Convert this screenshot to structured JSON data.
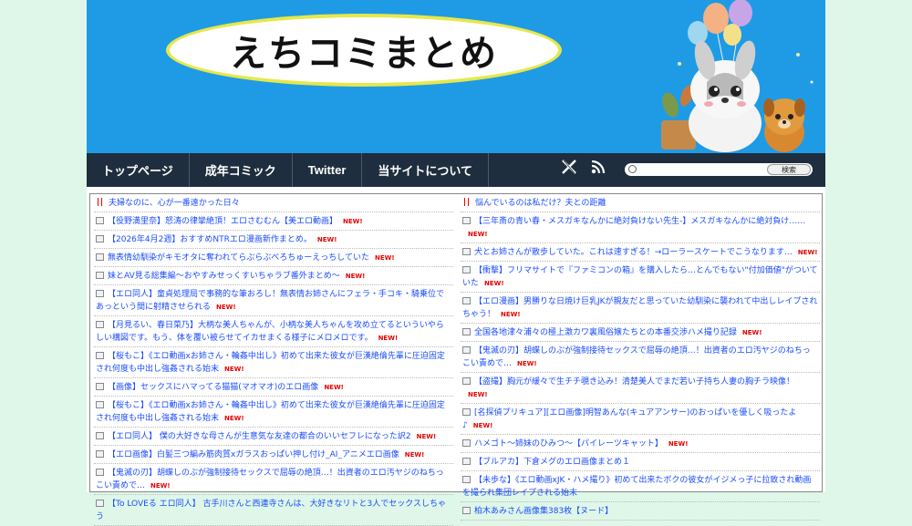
{
  "site": {
    "title": "えちコミまとめ",
    "nav": [
      "トップページ",
      "成年コミック",
      "Twitter",
      "当サイトについて"
    ],
    "search_button": "検索",
    "search_placeholder": ""
  },
  "new_label": "NEW!",
  "left_items": [
    {
      "text": "夫婦なのに、心が一番遠かった日々",
      "icon": "red",
      "new": false
    },
    {
      "text": "【役野満里奈】怒涛の律攣絶頂！エロさむむん【美エロ動画】",
      "icon": "doc",
      "new": true
    },
    {
      "text": "【2026年4月2週】おすすめNTRエロ漫画新作まとめ。",
      "icon": "doc",
      "new": true
    },
    {
      "text": "無表情幼馴染がキモオタに奪われてらぶらぶべろちゅーえっちしていた",
      "icon": "doc",
      "new": true
    },
    {
      "text": "妹とAV見る総集編〜おやすみせっくすいちゃラブ番外まとめ〜",
      "icon": "doc",
      "new": true
    },
    {
      "text": "【エロ同人】童貞処理局で事務的な筆おろし！無表情お姉さんにフェラ・手コキ・騎乗位であっという間に射精させられる",
      "icon": "doc",
      "new": true
    },
    {
      "text": "【月見るい、春日菜乃】大柄な美人ちゃんが、小柄な美人ちゃんを攻め立てるといういやらしい構図です。もう、体を覆い被らせてイカせまくる様子にメロメロです。",
      "icon": "doc",
      "new": true
    },
    {
      "text": "【桜もこ】《エロ動画xお姉さん・輪姦中出し》初めて出来た彼女が巨漢絶倫先輩に圧迫固定され何度も中出し強姦される始末",
      "icon": "doc",
      "new": true
    },
    {
      "text": "【画像】セックスにハマってる猫猫(マオマオ)のエロ画像",
      "icon": "doc",
      "new": true
    },
    {
      "text": "【桜もこ】《エロ動画xお姉さん・輪姦中出し》初めて出来た彼女が巨漢絶倫先輩に圧迫固定され何度も中出し強姦される始末",
      "icon": "doc",
      "new": true
    },
    {
      "text": "【エロ同人】 僕の大好きな母さんが生意気な友達の都合のいいセフレになった訳2",
      "icon": "doc",
      "new": true
    },
    {
      "text": "【エロ画像】白髪三つ編み筋肉質xガラスおっぱい押し付け_AI_アニメエロ画像",
      "icon": "doc",
      "new": true
    },
    {
      "text": "【鬼滅の刃】胡蝶しのぶが強制接待セックスで屈辱の絶頂…！出資者のエロ汚ヤジのねちっこい責めで…",
      "icon": "doc",
      "new": true
    },
    {
      "text": "【To LOVEる エロ同人】 古手川さんと西連寺さんは、大好きなリトと3人でセックスしちゃう",
      "icon": "doc",
      "new": false
    }
  ],
  "right_items": [
    {
      "text": "悩んでいるのは私だけ？夫との距離",
      "icon": "red",
      "new": false
    },
    {
      "text": "【三年斎の青い春・メスガキなんかに絶対負けない先生-】メスガキなんかに絶対負け……",
      "icon": "doc",
      "new": true
    },
    {
      "text": "犬とお姉さんが散歩していた。これは速すぎる！→ローラースケートでこうなります…",
      "icon": "doc",
      "new": true
    },
    {
      "text": "【衝撃】フリマサイトで『ファミコンの箱』を購入したら…とんでもない\"付加価値\"がついていた",
      "icon": "doc",
      "new": true
    },
    {
      "text": "【エロ漫画】男勝りな日焼け巨乳JKが親友だと思っていた幼馴染に襲われて中出しレイプされちゃう！",
      "icon": "doc",
      "new": true
    },
    {
      "text": "全国各地津々浦々の極上激カワ裏風俗嬢たちとの本番交渉ハメ撮り記録",
      "icon": "doc",
      "new": true
    },
    {
      "text": "【鬼滅の刃】胡蝶しのぶが強制接待セックスで屈辱の絶頂…！出資者のエロ汚ヤジのねちっこい責めで…",
      "icon": "doc",
      "new": true
    },
    {
      "text": "【盗撮】胸元が緩々で生チチ覗き込み！清楚美人でまだ若い子持ち人妻の胸チラ映像！",
      "icon": "doc",
      "new": true
    },
    {
      "text": "[名探偵プリキュア][エロ画像]明智あんな(キュアアンサー)のおっぱいを優しく吸ったよ♪",
      "icon": "doc",
      "new": true
    },
    {
      "text": "ハメゴト〜姉妹のひみつ〜【パイレーツキャット】",
      "icon": "doc",
      "new": true
    },
    {
      "text": "【ブルアカ】下倉メグのエロ画像まとめ１",
      "icon": "doc",
      "new": false
    },
    {
      "text": "【未歩な】《エロ動画xJK・ハメ撮り》初めて出来たボクの彼女がイジメっ子に拉致され動画を撮られ集団レイプされる始末",
      "icon": "doc",
      "new": false
    },
    {
      "text": "柏木あみさん画像集383枚【ヌード】",
      "icon": "doc",
      "new": false
    }
  ]
}
